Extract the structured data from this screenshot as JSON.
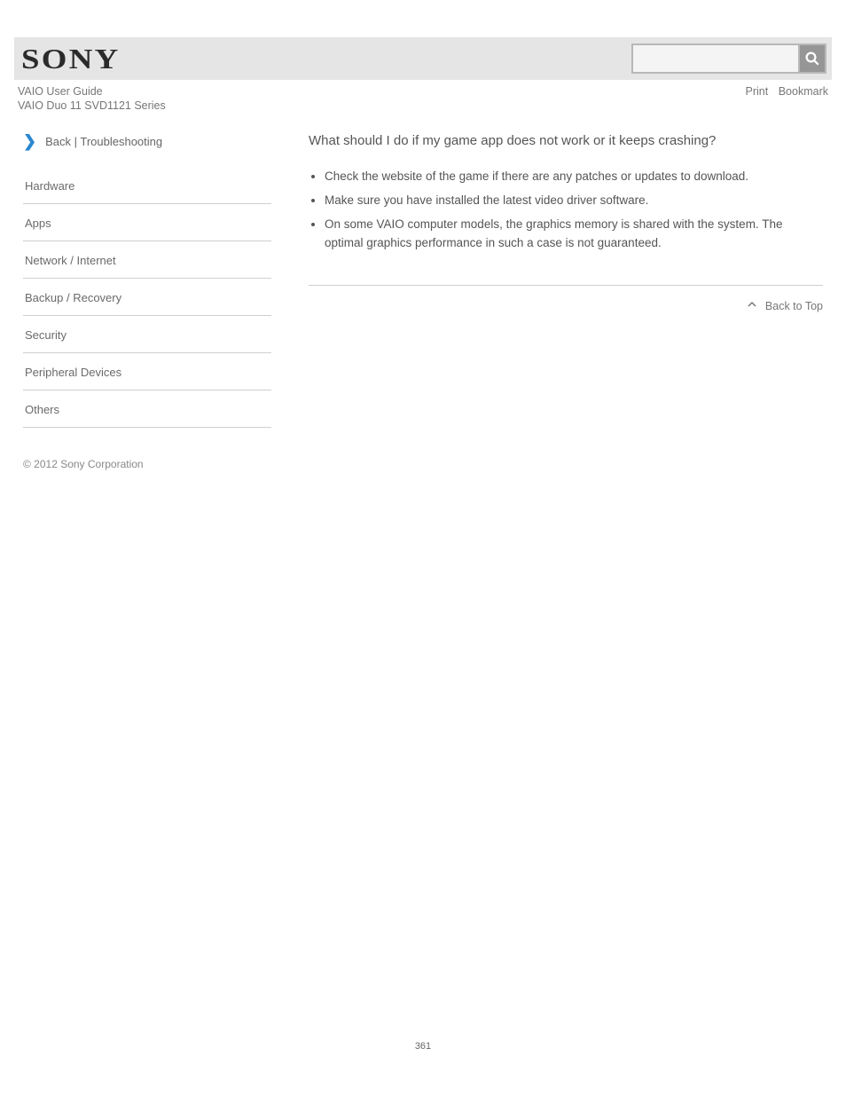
{
  "header": {
    "brand": "SONY",
    "search_placeholder": "",
    "guide_label": "VAIO User Guide",
    "print_label": "Print",
    "bookmark_label": "Bookmark",
    "product_line": "VAIO Duo 11   SVD1121 Series"
  },
  "sidebar": {
    "back_label": "Back",
    "heading": "Troubleshooting",
    "items": [
      "Hardware",
      "Apps",
      "Network / Internet",
      "Backup / Recovery",
      "Security",
      "Peripheral Devices",
      "Others"
    ]
  },
  "article": {
    "title": "What should I do if my game app does not work or it keeps crashing?",
    "bullets": [
      "Check the website of the game if there are any patches or updates to download.",
      "Make sure you have installed the latest video driver software.",
      "On some VAIO computer models, the graphics memory is shared with the system. The optimal graphics performance in such a case is not guaranteed."
    ],
    "back_to_top": "Back to Top"
  },
  "footer": {
    "copyright": "© 2012 Sony Corporation",
    "page_number": "361"
  }
}
